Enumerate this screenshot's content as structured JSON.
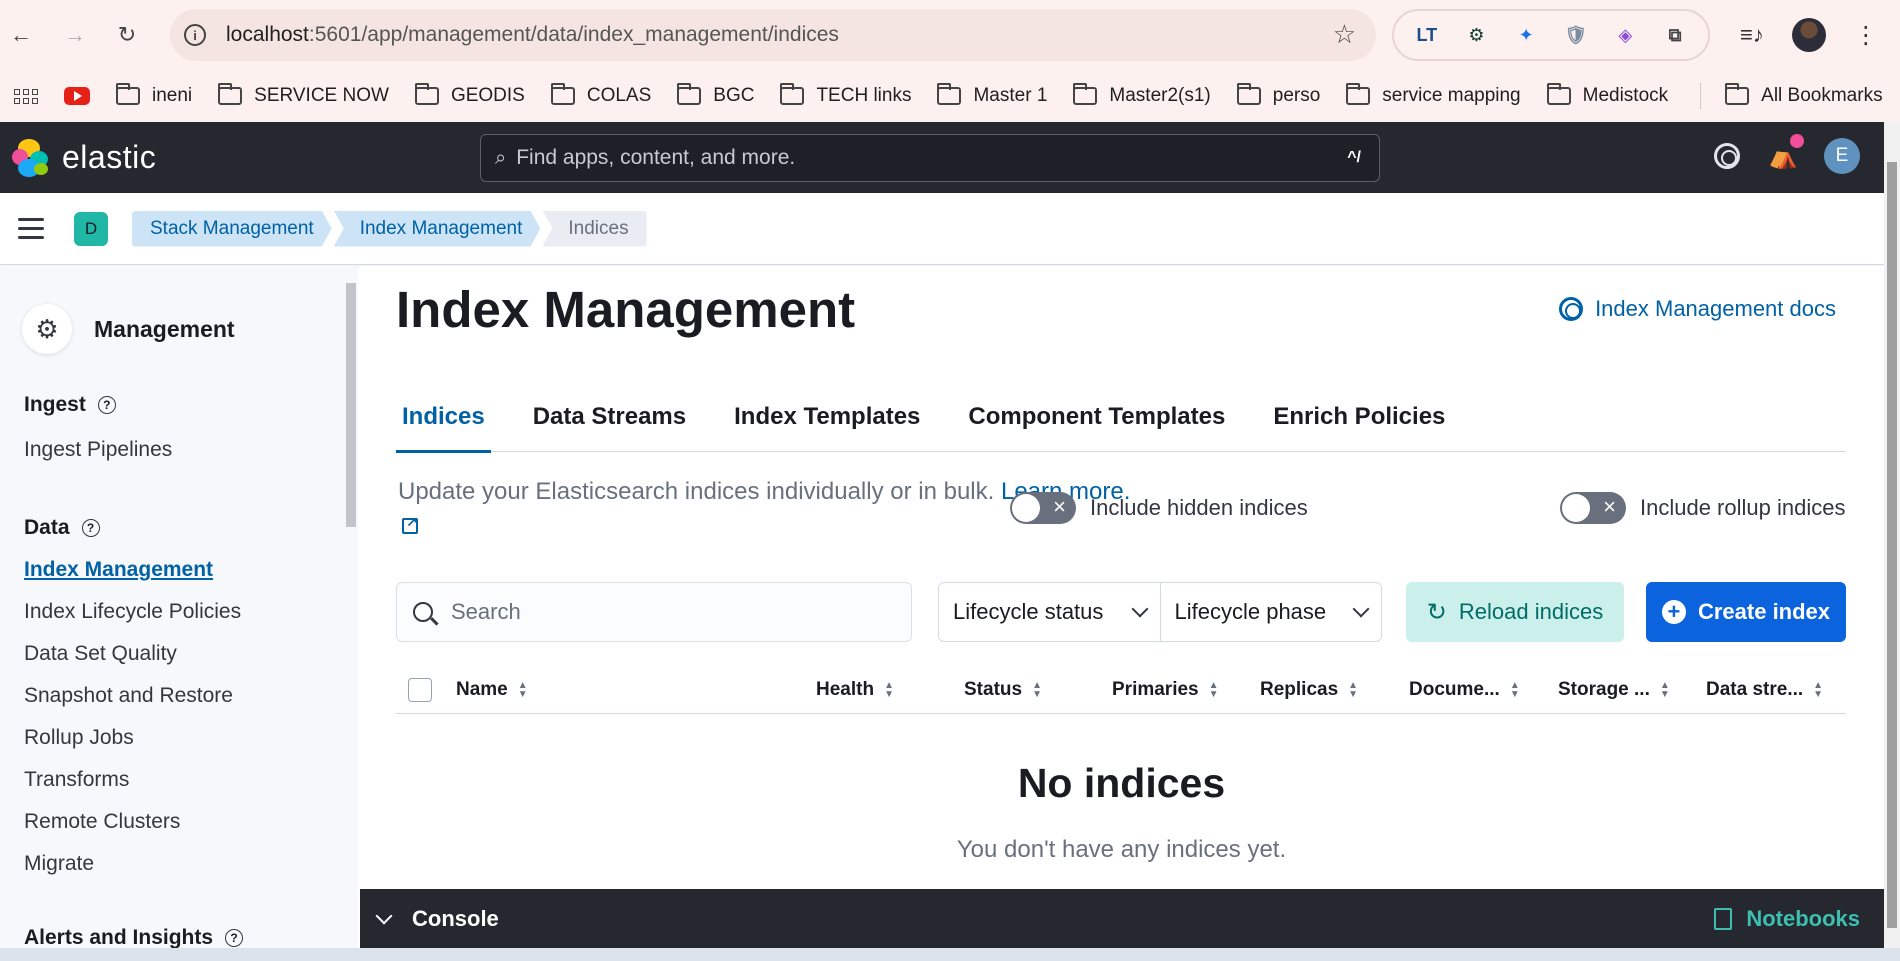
{
  "browser": {
    "url_host": "localhost",
    "url_rest": ":5601/app/management/data/index_management/indices",
    "extensions": [
      "LT",
      "⚙",
      "✦",
      "🛡",
      "◈",
      "⧉"
    ],
    "bookmarks": [
      "ineni",
      "SERVICE NOW",
      "GEODIS",
      "COLAS",
      "BGC",
      "TECH links",
      "Master 1",
      "Master2(s1)",
      "perso",
      "service mapping",
      "Medistock"
    ],
    "all_bookmarks": "All Bookmarks"
  },
  "header": {
    "logo_text": "elastic",
    "search_placeholder": "Find apps, content, and more.",
    "search_shortcut": "^/",
    "user_initial": "E"
  },
  "breadcrumbs": {
    "space_initial": "D",
    "items": [
      "Stack Management",
      "Index Management",
      "Indices"
    ]
  },
  "sidebar": {
    "title": "Management",
    "groups": [
      {
        "label": "Ingest",
        "items": [
          "Ingest Pipelines"
        ]
      },
      {
        "label": "Data",
        "items": [
          "Index Management",
          "Index Lifecycle Policies",
          "Data Set Quality",
          "Snapshot and Restore",
          "Rollup Jobs",
          "Transforms",
          "Remote Clusters",
          "Migrate"
        ]
      },
      {
        "label": "Alerts and Insights",
        "items": []
      }
    ],
    "active_item": "Index Management"
  },
  "main": {
    "title": "Index Management",
    "docs_link": "Index Management docs",
    "tabs": [
      "Indices",
      "Data Streams",
      "Index Templates",
      "Component Templates",
      "Enrich Policies"
    ],
    "active_tab": "Indices",
    "description": "Update your Elasticsearch indices individually or in bulk.",
    "learn_more": "Learn more.",
    "toggle_hidden": "Include hidden indices",
    "toggle_rollup": "Include rollup indices",
    "search_placeholder": "Search",
    "filter_lifecycle_status": "Lifecycle status",
    "filter_lifecycle_phase": "Lifecycle phase",
    "reload_button": "Reload indices",
    "create_button": "Create index",
    "columns": [
      "Name",
      "Health",
      "Status",
      "Primaries",
      "Replicas",
      "Docume...",
      "Storage ...",
      "Data stre..."
    ],
    "empty_title": "No indices",
    "empty_subtitle": "You don't have any indices yet."
  },
  "console": {
    "label": "Console",
    "notebooks": "Notebooks"
  },
  "colors": {
    "primary": "#0b64dd",
    "link": "#0061a6",
    "header_bg": "#25282f",
    "success_text": "#006c66"
  }
}
